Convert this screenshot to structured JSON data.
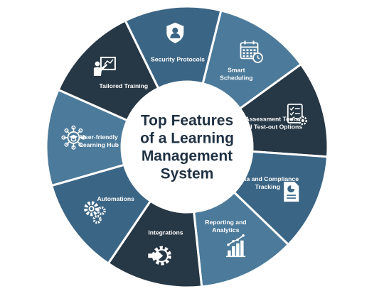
{
  "center": {
    "title_lines": [
      "Top Features",
      "of a Learning",
      "Management",
      "System"
    ]
  },
  "colors": {
    "dark": "#263745",
    "blue": "#3b6585",
    "mid": "#4c7a9a",
    "center": "#ffffff",
    "center_text": "#1f3142",
    "label": "#ffffff"
  },
  "segments": [
    {
      "label_lines": [
        "User-friendly",
        "Learning Hub"
      ],
      "icon": "network-graduation-cap-icon",
      "color": "mid"
    },
    {
      "label_lines": [
        "Tailored Training"
      ],
      "icon": "teacher-board-icon",
      "color": "dark"
    },
    {
      "label_lines": [
        "Security Protocols"
      ],
      "icon": "shield-user-icon",
      "color": "blue"
    },
    {
      "label_lines": [
        "Smart",
        "Scheduling"
      ],
      "icon": "calendar-clock-icon",
      "color": "mid"
    },
    {
      "label_lines": [
        "Assessment Tools",
        "and Test-out Options"
      ],
      "icon": "checklist-gear-icon",
      "color": "dark"
    },
    {
      "label_lines": [
        "Data and Compliance",
        "Tracking"
      ],
      "icon": "pie-document-icon",
      "color": "blue"
    },
    {
      "label_lines": [
        "Reporting and",
        "Analytics"
      ],
      "icon": "bar-chart-trend-icon",
      "color": "mid"
    },
    {
      "label_lines": [
        "Integrations"
      ],
      "icon": "integration-gear-icon",
      "color": "dark"
    },
    {
      "label_lines": [
        "Automations"
      ],
      "icon": "gears-icon",
      "color": "blue"
    }
  ]
}
